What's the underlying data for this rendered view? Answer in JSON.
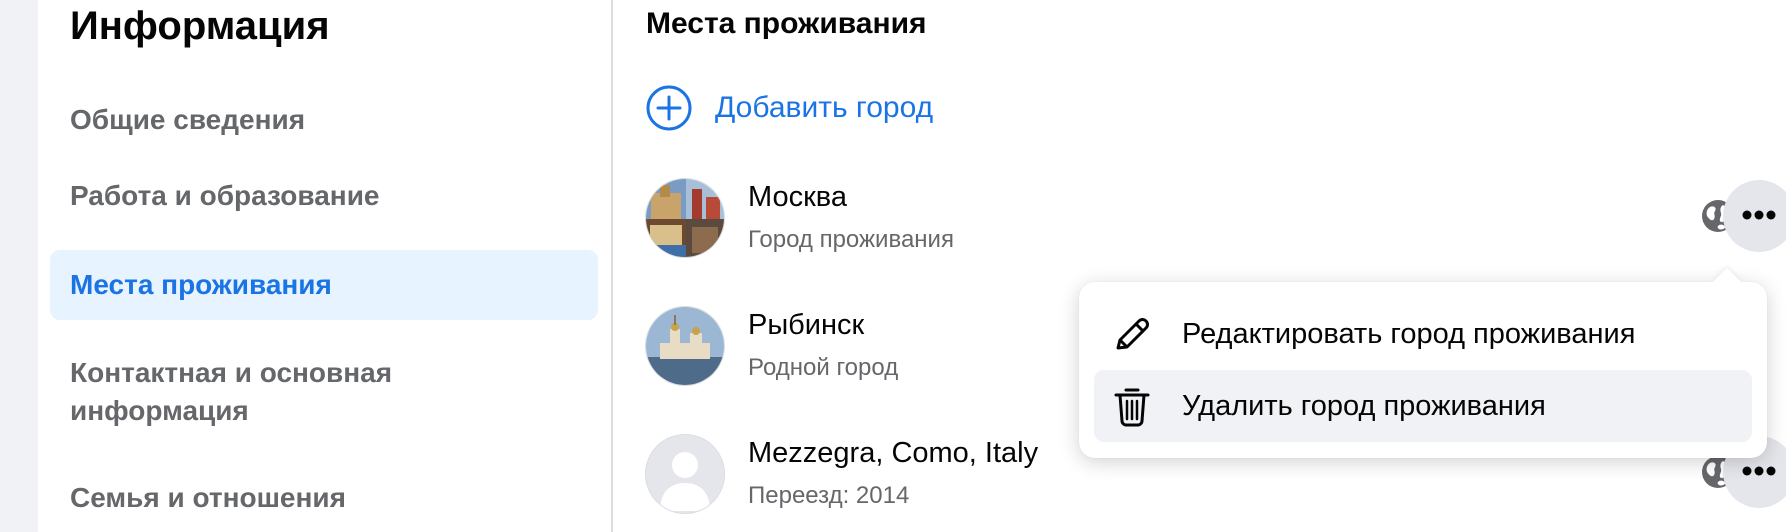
{
  "sidebar": {
    "title": "Информация",
    "items": [
      {
        "label": "Общие сведения",
        "active": false
      },
      {
        "label": "Работа и образование",
        "active": false
      },
      {
        "label": "Места проживания",
        "active": true
      },
      {
        "label": "Контактная и основная информация",
        "active": false
      },
      {
        "label": "Семья и отношения",
        "active": false
      }
    ]
  },
  "main": {
    "section_title": "Места проживания",
    "add_label": "Добавить город",
    "places": [
      {
        "name": "Москва",
        "sub": "Город проживания",
        "avatar": "moscow-collage-photo"
      },
      {
        "name": "Рыбинск",
        "sub": "Родной город",
        "avatar": "rybinsk-cathedral-photo"
      },
      {
        "name": "Mezzegra, Como, Italy",
        "sub": "Переезд: 2014",
        "avatar": "default-avatar"
      }
    ]
  },
  "menu": {
    "items": [
      {
        "label": "Редактировать город проживания",
        "icon": "pencil-icon"
      },
      {
        "label": "Удалить город проживания",
        "icon": "trash-icon"
      }
    ]
  },
  "colors": {
    "accent": "#1b74e4",
    "active_bg": "#e7f3ff",
    "secondary_text": "#65676b",
    "button_bg": "#e4e6eb"
  }
}
